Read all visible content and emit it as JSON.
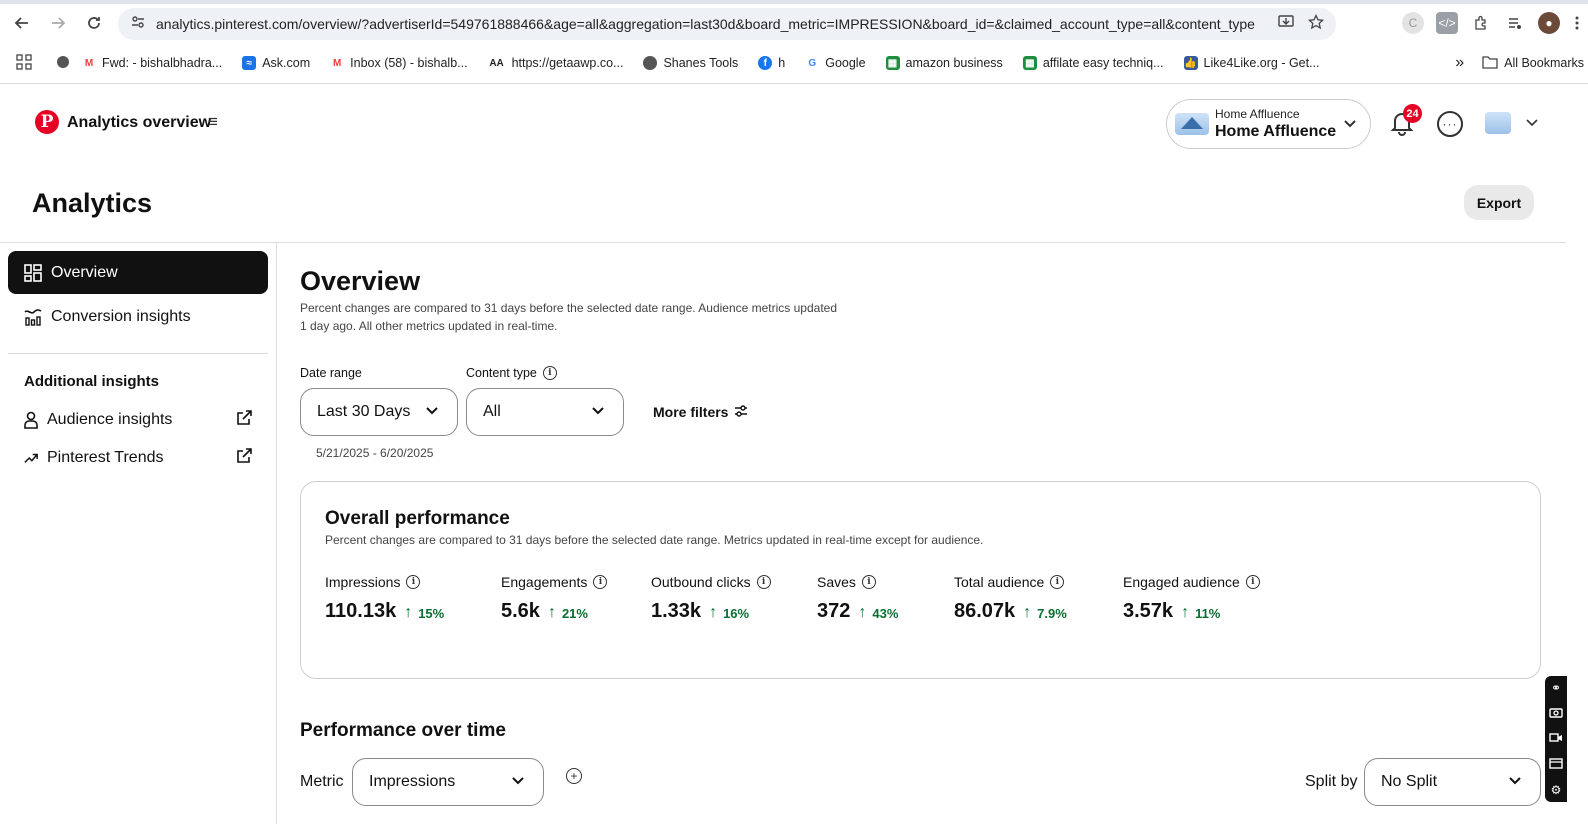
{
  "browser": {
    "url": "analytics.pinterest.com/overview/?advertiserId=549761888466&age=all&aggregation=last30d&board_metric=IMPRESSION&board_id=&claimed_account_type=all&content_type...",
    "bookmarks": [
      {
        "label": "Fwd: - bishalbhadra...",
        "icon": "gmail-icon",
        "color": "#ea4335"
      },
      {
        "label": "Ask.com",
        "icon": "ask-icon",
        "color": "#1a73e8"
      },
      {
        "label": "Inbox (58) - bishalb...",
        "icon": "gmail-icon",
        "color": "#ea4335"
      },
      {
        "label": "https://getaawp.co...",
        "icon": "aa-icon",
        "color": "#222222"
      },
      {
        "label": "Shanes Tools",
        "icon": "globe-icon",
        "color": "#555555"
      },
      {
        "label": "h",
        "icon": "facebook-icon",
        "color": "#1877f2"
      },
      {
        "label": "Google",
        "icon": "google-icon",
        "color": "#4285f4"
      },
      {
        "label": "amazon business",
        "icon": "sheet-icon",
        "color": "#1e8e3e"
      },
      {
        "label": "affilate easy techniq...",
        "icon": "sheet-icon",
        "color": "#1e8e3e"
      },
      {
        "label": "Like4Like.org - Get...",
        "icon": "thumb-icon",
        "color": "#3b5998"
      }
    ],
    "all_bookmarks": "All Bookmarks",
    "more_chevrons": "»"
  },
  "header": {
    "app_title": "Analytics overview",
    "account_small": "Home Affluence",
    "account_big": "Home Affluence",
    "notification_count": "24"
  },
  "page": {
    "title": "Analytics",
    "export_label": "Export"
  },
  "sidebar": {
    "items": [
      {
        "label": "Overview"
      },
      {
        "label": "Conversion insights"
      }
    ],
    "additional_heading": "Additional insights",
    "additional_items": [
      {
        "label": "Audience insights"
      },
      {
        "label": "Pinterest Trends"
      }
    ]
  },
  "overview": {
    "title": "Overview",
    "subtitle": "Percent changes are compared to 31 days before the selected date range. Audience metrics updated 1 day ago. All other metrics updated in real-time.",
    "date_range_label": "Date range",
    "date_range_value": "Last 30 Days",
    "content_type_label": "Content type",
    "content_type_value": "All",
    "more_filters": "More filters",
    "date_note": "5/21/2025 - 6/20/2025"
  },
  "performance": {
    "title": "Overall performance",
    "subtitle": "Percent changes are compared to 31 days before the selected date range. Metrics updated in real-time except for audience.",
    "metrics": [
      {
        "label": "Impressions",
        "value": "110.13k",
        "change": "15%"
      },
      {
        "label": "Engagements",
        "value": "5.6k",
        "change": "21%"
      },
      {
        "label": "Outbound clicks",
        "value": "1.33k",
        "change": "16%"
      },
      {
        "label": "Saves",
        "value": "372",
        "change": "43%"
      },
      {
        "label": "Total audience",
        "value": "86.07k",
        "change": "7.9%"
      },
      {
        "label": "Engaged audience",
        "value": "3.57k",
        "change": "11%"
      }
    ]
  },
  "over_time": {
    "title": "Performance over time",
    "metric_label": "Metric",
    "metric_value": "Impressions",
    "split_label": "Split by",
    "split_value": "No Split"
  },
  "colors": {
    "brand": "#e60023",
    "positive": "#0a6e31",
    "active_nav": "#111111"
  }
}
